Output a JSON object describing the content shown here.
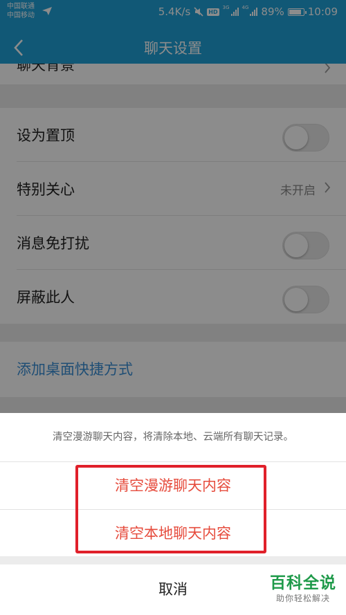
{
  "status_bar": {
    "carrier1": "中国联通",
    "carrier2": "中国移动",
    "speed": "5.4K/s",
    "hd": "HD",
    "net1": "3G",
    "net2": "4G",
    "battery": "89%",
    "battery_level": 0.89,
    "time": "10:09"
  },
  "nav": {
    "title": "聊天设置"
  },
  "settings": {
    "background_label": "聊天背景",
    "pin_label": "设为置顶",
    "special_care_label": "特别关心",
    "special_care_status": "未开启",
    "dnd_label": "消息免打扰",
    "block_label": "屏蔽此人",
    "shortcut_label": "添加桌面快捷方式"
  },
  "sheet": {
    "message": "清空漫游聊天内容，将清除本地、云端所有聊天记录。",
    "action1": "清空漫游聊天内容",
    "action2": "清空本地聊天内容",
    "cancel": "取消"
  },
  "watermark": {
    "title": "百科全说",
    "subtitle": "助你轻松解决"
  },
  "colors": {
    "header_bg": "#1fa0d8",
    "destructive": "#e64b3c",
    "link": "#3a8ed6",
    "highlight": "#e0202a",
    "watermark": "#1f9a4a"
  }
}
